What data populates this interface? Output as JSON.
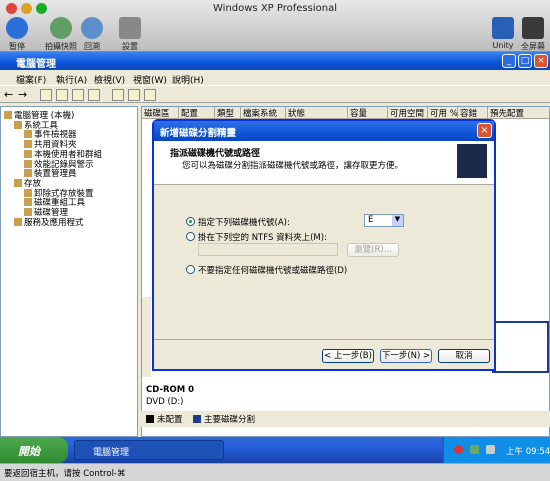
{
  "mac": {
    "title": "Windows XP Professional",
    "toolbar": {
      "pause": "暂停",
      "snapshot": "拍攝快照",
      "revert": "回溯",
      "settings": "設置",
      "unity": "Unity",
      "fullscreen": "全屏幕"
    }
  },
  "window": {
    "title": "電腦管理",
    "menus": [
      "檔案(F)",
      "執行(A)",
      "檢視(V)",
      "視窗(W)",
      "說明(H)"
    ]
  },
  "tree": [
    {
      "label": "電腦管理 (本機)",
      "indent": 0
    },
    {
      "label": "系統工具",
      "indent": 1
    },
    {
      "label": "事件檢視器",
      "indent": 2
    },
    {
      "label": "共用資料夾",
      "indent": 2
    },
    {
      "label": "本機使用者和群組",
      "indent": 2
    },
    {
      "label": "效能記錄與警示",
      "indent": 2
    },
    {
      "label": "裝置管理員",
      "indent": 2
    },
    {
      "label": "存放",
      "indent": 1
    },
    {
      "label": "卸除式存放裝置",
      "indent": 2
    },
    {
      "label": "磁碟重組工具",
      "indent": 2
    },
    {
      "label": "磁碟管理",
      "indent": 2
    },
    {
      "label": "服務及應用程式",
      "indent": 1
    }
  ],
  "columns": [
    "磁碟區",
    "配置",
    "類型",
    "檔案系統",
    "狀態",
    "容量",
    "可用空間",
    "可用 %",
    "容錯",
    "預先配置"
  ],
  "cdrom": {
    "name": "CD-ROM 0",
    "type": "DVD (D:)"
  },
  "legend": [
    "未配置",
    "主要磁碟分割"
  ],
  "dialog": {
    "title": "新增磁碟分割精靈",
    "header_title": "指派磁碟機代號或路徑",
    "header_desc": "您可以為磁碟分割指派磁碟機代號或路徑，讓存取更方便。",
    "options": [
      "指定下列磁碟機代號(A):",
      "掛在下列空的 NTFS 資料夾上(M):",
      "不要指定任何磁碟機代號或磁碟路徑(D)"
    ],
    "drive_letter": "E",
    "browse": "瀏覽(R)...",
    "back": "< 上一步(B)",
    "next": "下一步(N) >",
    "cancel": "取消"
  },
  "taskbar": {
    "start": "開始",
    "item": "電腦管理",
    "time": "上午 09:54"
  },
  "status": "要返回宿主机，请按 Control-⌘"
}
